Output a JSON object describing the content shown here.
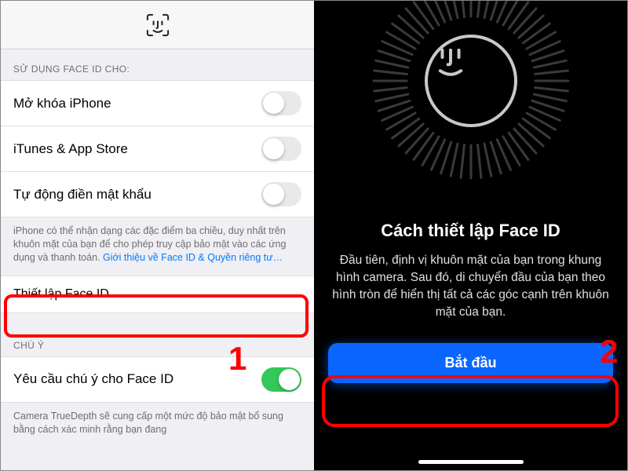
{
  "left": {
    "section1_header": "SỬ DỤNG FACE ID CHO:",
    "rows": [
      {
        "label": "Mở khóa iPhone",
        "on": false
      },
      {
        "label": "iTunes & App Store",
        "on": false
      },
      {
        "label": "Tự động điền mật khẩu",
        "on": false
      }
    ],
    "footer1_pre": "iPhone có thể nhận dạng các đặc điểm ba chiều, duy nhất trên khuôn mặt của bạn để cho phép truy cập bảo mật vào các ứng dụng và thanh toán. ",
    "footer1_link": "Giới thiệu về Face ID & Quyền riêng tư…",
    "setup_label": "Thiết lập Face ID",
    "section2_header": "CHÚ Ý",
    "attention_label": "Yêu cầu chú ý cho Face ID",
    "attention_on": true,
    "footer2": "Camera TrueDepth sẽ cung cấp một mức độ bảo mật bổ sung bằng cách xác minh rằng bạn đang"
  },
  "right": {
    "title": "Cách thiết lập Face ID",
    "body": "Đầu tiên, định vị khuôn mặt của bạn trong khung hình camera. Sau đó, di chuyển đầu của bạn theo hình tròn để hiển thị tất cả các góc cạnh trên khuôn mặt của bạn.",
    "button": "Bắt đầu"
  },
  "annotations": {
    "one": "1",
    "two": "2"
  }
}
